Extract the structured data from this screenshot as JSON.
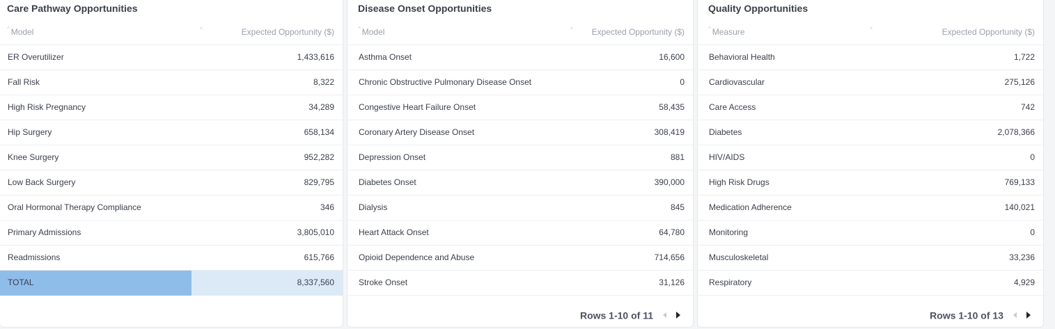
{
  "care_pathway": {
    "title": "Care Pathway Opportunities",
    "col_left": "Model",
    "col_right": "Expected Opportunity ($)",
    "rows": [
      {
        "name": "ER Overutilizer",
        "value": "1,433,616"
      },
      {
        "name": "Fall Risk",
        "value": "8,322"
      },
      {
        "name": "High Risk Pregnancy",
        "value": "34,289"
      },
      {
        "name": "Hip Surgery",
        "value": "658,134"
      },
      {
        "name": "Knee Surgery",
        "value": "952,282"
      },
      {
        "name": "Low Back Surgery",
        "value": "829,795"
      },
      {
        "name": "Oral Hormonal Therapy Compliance",
        "value": "346"
      },
      {
        "name": "Primary Admissions",
        "value": "3,805,010"
      },
      {
        "name": "Readmissions",
        "value": "615,766"
      }
    ],
    "total_label": "TOTAL",
    "total_value": "8,337,560"
  },
  "disease_onset": {
    "title": "Disease Onset Opportunities",
    "col_left": "Model",
    "col_right": "Expected Opportunity ($)",
    "rows": [
      {
        "name": "Asthma Onset",
        "value": "16,600"
      },
      {
        "name": "Chronic Obstructive Pulmonary Disease Onset",
        "value": "0"
      },
      {
        "name": "Congestive Heart Failure Onset",
        "value": "58,435"
      },
      {
        "name": "Coronary Artery Disease Onset",
        "value": "308,419"
      },
      {
        "name": "Depression Onset",
        "value": "881"
      },
      {
        "name": "Diabetes Onset",
        "value": "390,000"
      },
      {
        "name": "Dialysis",
        "value": "845"
      },
      {
        "name": "Heart Attack Onset",
        "value": "64,780"
      },
      {
        "name": "Opioid Dependence and Abuse",
        "value": "714,656"
      },
      {
        "name": "Stroke Onset",
        "value": "31,126"
      }
    ],
    "pager": "Rows 1-10 of 11"
  },
  "quality": {
    "title": "Quality Opportunities",
    "col_left": "Measure",
    "col_right": "Expected Opportunity ($)",
    "rows": [
      {
        "name": "Behavioral Health",
        "value": "1,722"
      },
      {
        "name": "Cardiovascular",
        "value": "275,126"
      },
      {
        "name": "Care Access",
        "value": "742"
      },
      {
        "name": "Diabetes",
        "value": "2,078,366"
      },
      {
        "name": "HIV/AIDS",
        "value": "0"
      },
      {
        "name": "High Risk Drugs",
        "value": "769,133"
      },
      {
        "name": "Medication Adherence",
        "value": "140,021"
      },
      {
        "name": "Monitoring",
        "value": "0"
      },
      {
        "name": "Musculoskeletal",
        "value": "33,236"
      },
      {
        "name": "Respiratory",
        "value": "4,929"
      }
    ],
    "pager": "Rows 1-10 of 13"
  },
  "colors": {
    "total_label_bg": "#8fbdea",
    "total_value_bg": "#dceaf8",
    "border": "#eceef1"
  },
  "icons": {
    "sort": "sort-arrow-icon",
    "prev": "previous-page-icon",
    "next": "next-page-icon"
  }
}
